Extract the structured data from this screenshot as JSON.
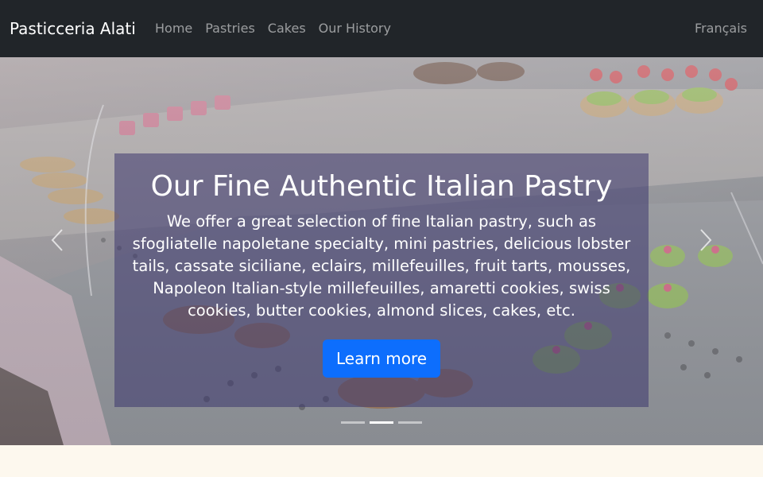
{
  "navbar": {
    "brand": "Pasticceria Alati",
    "links": [
      {
        "label": "Home"
      },
      {
        "label": "Pastries"
      },
      {
        "label": "Cakes"
      },
      {
        "label": "Our History"
      }
    ],
    "language": "Français"
  },
  "carousel": {
    "slide_count": 3,
    "active_slide": 2,
    "caption": {
      "title": "Our Fine Authentic Italian Pastry",
      "text": "We offer a great selection of fine Italian pastry, such as sfogliatelle napoletane specialty, mini pastries, delicious lobster tails, cassate siciliane, eclairs, millefeuilles, fruit tarts, mousses, Napoleon Italian-style millefeuilles, amaretti cookies, swiss cookies, butter cookies, almond slices, cakes, etc.",
      "button": "Learn more"
    },
    "icons": {
      "prev": "chevron-left-icon",
      "next": "chevron-right-icon"
    }
  },
  "colors": {
    "navbar": "#212529",
    "button": "#0d6efd",
    "page_background": "#fdf8ee"
  }
}
